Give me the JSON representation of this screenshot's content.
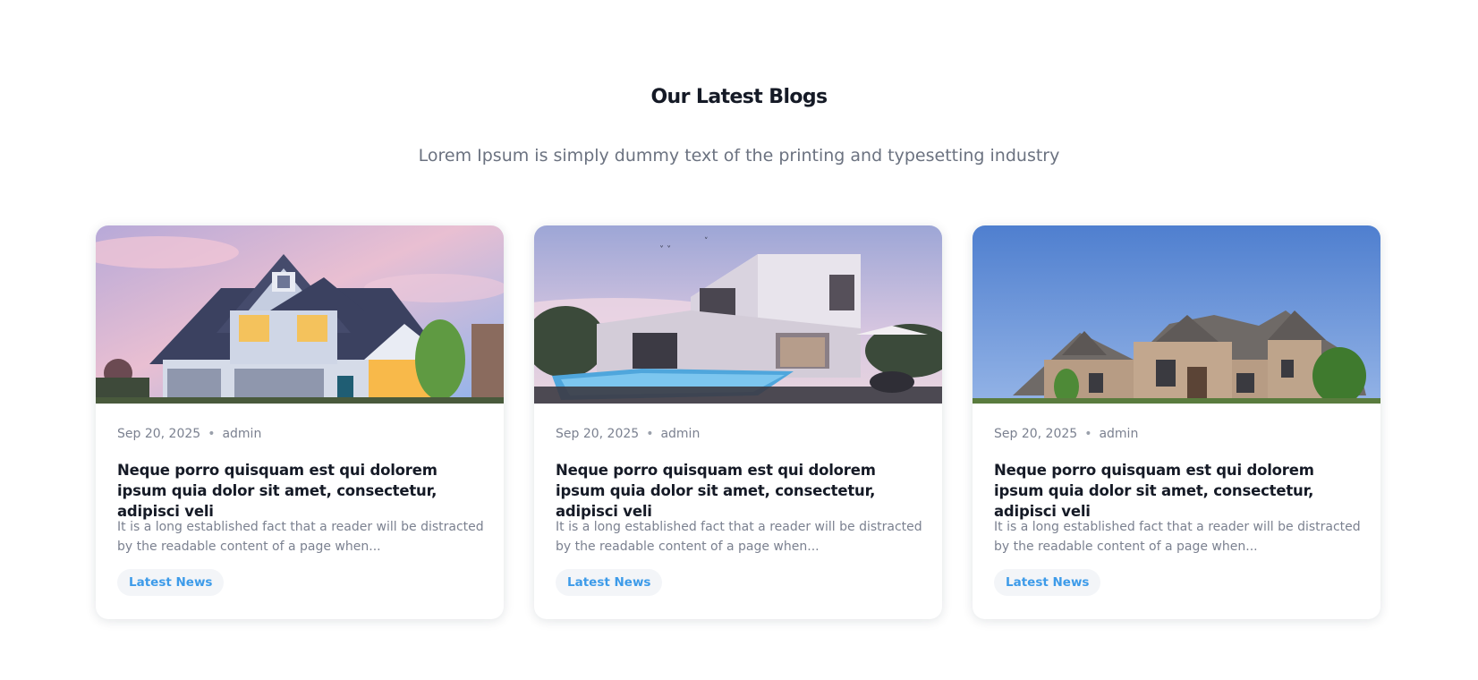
{
  "section": {
    "title": "Our Latest Blogs",
    "subtitle": "Lorem Ipsum is simply dummy text of the printing and typesetting industry"
  },
  "posts": [
    {
      "image": "house-suburban-dusk",
      "date": "Sep 20, 2025",
      "separator": "•",
      "author": "admin",
      "title": "Neque porro quisquam est qui dolorem ipsum quia dolor sit amet, consectetur, adipisci veli",
      "excerpt": "It is a long established fact that a reader will be distracted by the readable content of a page when...",
      "tag": "Latest News"
    },
    {
      "image": "modern-villa-pool",
      "date": "Sep 20, 2025",
      "separator": "•",
      "author": "admin",
      "title": "Neque porro quisquam est qui dolorem ipsum quia dolor sit amet, consectetur, adipisci veli",
      "excerpt": "It is a long established fact that a reader will be distracted by the readable content of a page when...",
      "tag": "Latest News"
    },
    {
      "image": "stone-mansion-blue-sky",
      "date": "Sep 20, 2025",
      "separator": "•",
      "author": "admin",
      "title": "Neque porro quisquam est qui dolorem ipsum quia dolor sit amet, consectetur, adipisci veli",
      "excerpt": "It is a long established fact that a reader will be distracted by the readable content of a page when...",
      "tag": "Latest News"
    }
  ],
  "colors": {
    "heading": "#151a26",
    "muted": "#7b8190",
    "tag_text": "#3d9be9",
    "tag_bg": "#f3f5f8"
  }
}
